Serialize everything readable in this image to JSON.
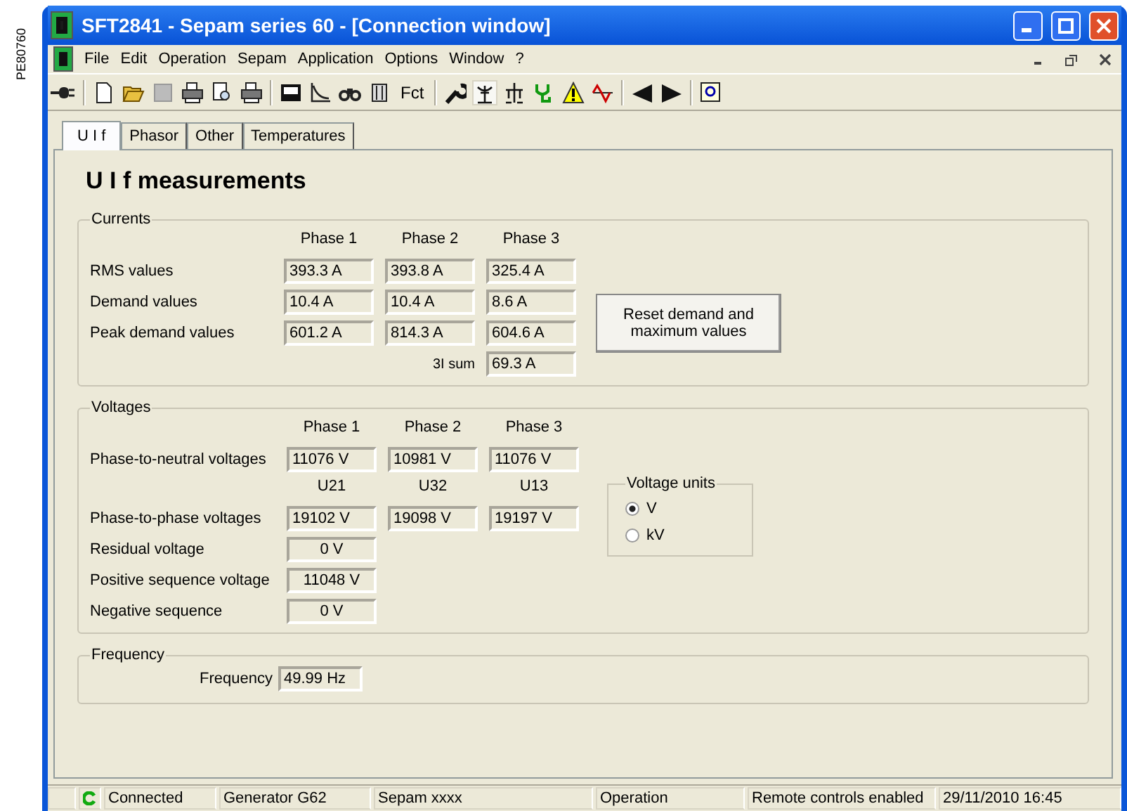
{
  "side_label": "PE80760",
  "window": {
    "title": "SFT2841 - Sepam series 60 - [Connection window]"
  },
  "menu": [
    "File",
    "Edit",
    "Operation",
    "Sepam",
    "Application",
    "Options",
    "Window",
    "?"
  ],
  "toolbar": {
    "text_button": "Fct"
  },
  "tabs": [
    {
      "label": "U I f",
      "selected": true
    },
    {
      "label": "Phasor",
      "selected": false
    },
    {
      "label": "Other",
      "selected": false
    },
    {
      "label": "Temperatures",
      "selected": false
    }
  ],
  "heading": "U I f measurements",
  "currents": {
    "title": "Currents",
    "columns": [
      "Phase 1",
      "Phase 2",
      "Phase 3"
    ],
    "rows": [
      {
        "label": "RMS values",
        "values": [
          "393.3 A",
          "393.8 A",
          "325.4 A"
        ]
      },
      {
        "label": "Demand values",
        "values": [
          "10.4 A",
          "10.4 A",
          "8.6 A"
        ]
      },
      {
        "label": "Peak demand values",
        "values": [
          "601.2 A",
          "814.3 A",
          "604.6 A"
        ]
      }
    ],
    "sum_label": "3I sum",
    "sum_value": "69.3 A",
    "reset_button": "Reset demand and maximum values"
  },
  "voltages": {
    "title": "Voltages",
    "neutral_columns": [
      "Phase 1",
      "Phase 2",
      "Phase 3"
    ],
    "neutral": {
      "label": "Phase-to-neutral voltages",
      "values": [
        "11076 V",
        "10981 V",
        "11076 V"
      ]
    },
    "phase_columns": [
      "U21",
      "U32",
      "U13"
    ],
    "phase": {
      "label": "Phase-to-phase voltages",
      "values": [
        "19102 V",
        "19098 V",
        "19197 V"
      ]
    },
    "single": [
      {
        "label": "Residual voltage",
        "value": "0 V"
      },
      {
        "label": "Positive sequence voltage",
        "value": "11048 V"
      },
      {
        "label": "Negative sequence",
        "value": "0 V"
      }
    ],
    "units": {
      "title": "Voltage units",
      "options": [
        {
          "label": "V",
          "selected": true
        },
        {
          "label": "kV",
          "selected": false
        }
      ]
    }
  },
  "frequency": {
    "title": "Frequency",
    "label": "Frequency",
    "value": "49.99 Hz"
  },
  "status_bar": [
    "Connected",
    "Generator G62",
    "Sepam xxxx",
    "Operation",
    "Remote controls enabled",
    "29/11/2010 16:45"
  ]
}
